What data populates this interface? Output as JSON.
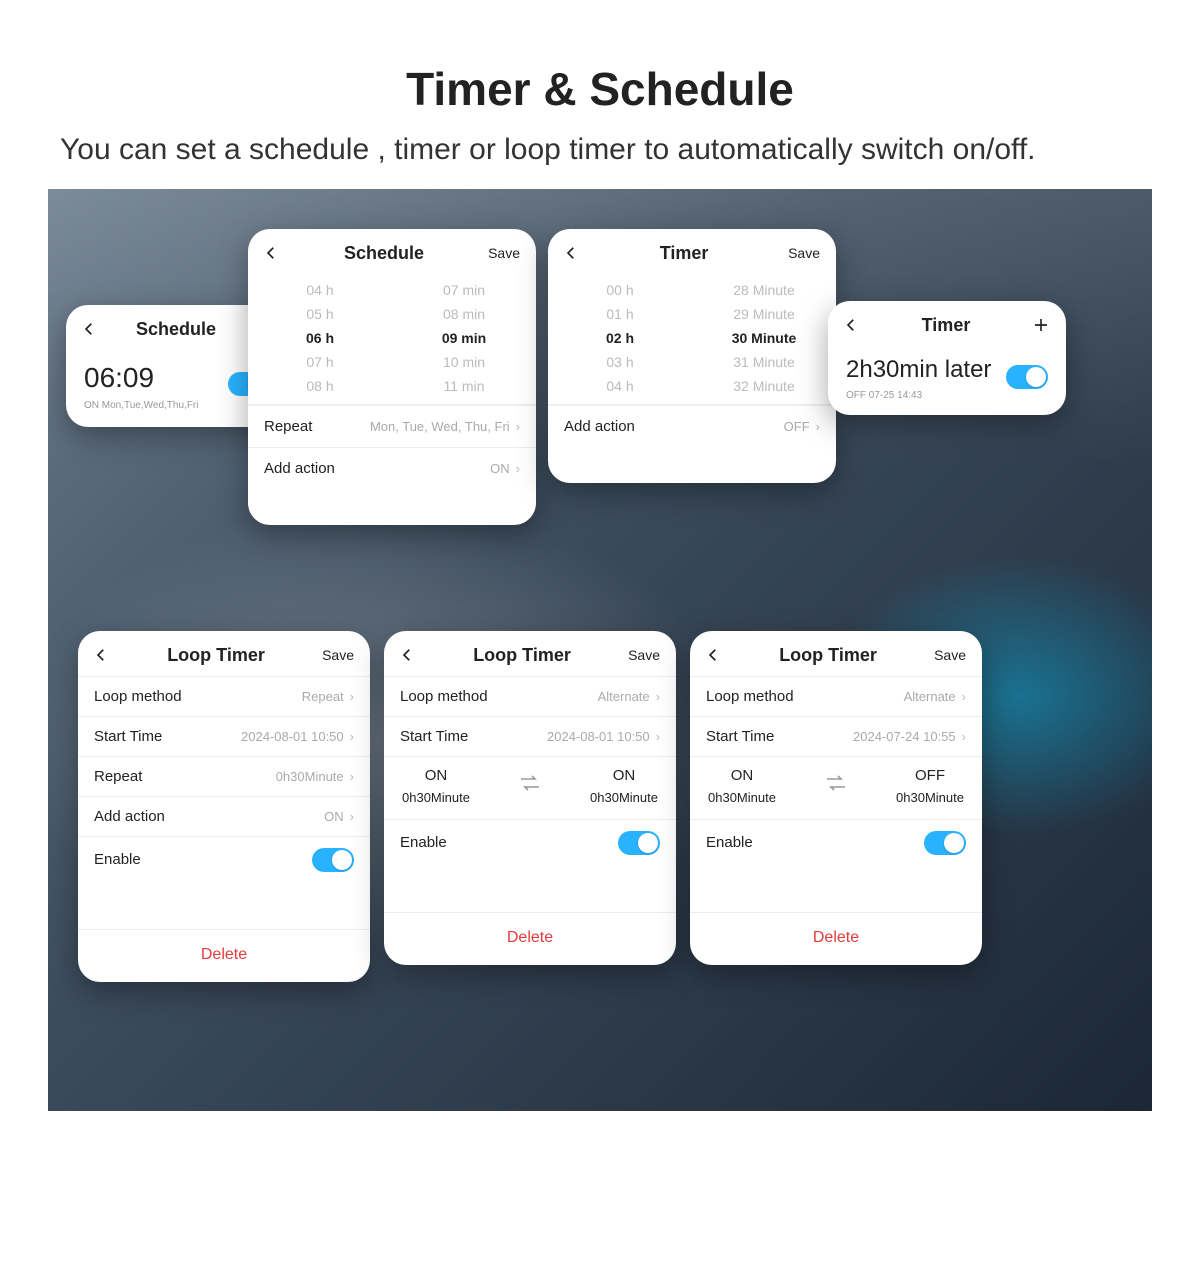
{
  "colors": {
    "accent": "#29b3ff",
    "danger": "#e43b3b"
  },
  "labels": {
    "save": "Save",
    "delete": "Delete",
    "add_action": "Add action",
    "enable": "Enable",
    "repeat": "Repeat",
    "loop_method": "Loop method",
    "start_time": "Start Time"
  },
  "header": {
    "title": "Timer & Schedule",
    "subtitle": "You can set a schedule , timer or loop timer to automatically switch on/off."
  },
  "schedule_small": {
    "title": "Schedule",
    "time": "06:09",
    "status": "ON   Mon,Tue,Wed,Thu,Fri",
    "toggle_on": true
  },
  "schedule_big": {
    "title": "Schedule",
    "hours": [
      "04 h",
      "05 h",
      "06 h",
      "07 h",
      "08 h"
    ],
    "minutes": [
      "07 min",
      "08 min",
      "09 min",
      "10 min",
      "11 min"
    ],
    "selected_hour_index": 2,
    "selected_minute_index": 2,
    "repeat_value": "Mon, Tue, Wed, Thu, Fri",
    "action_value": "ON"
  },
  "timer_big": {
    "title": "Timer",
    "hours": [
      "00 h",
      "01 h",
      "02 h",
      "03 h",
      "04 h"
    ],
    "minutes": [
      "28 Minute",
      "29 Minute",
      "30 Minute",
      "31 Minute",
      "32 Minute"
    ],
    "selected_hour_index": 2,
    "selected_minute_index": 2,
    "action_value": "OFF"
  },
  "timer_small": {
    "title": "Timer",
    "main": "2h30min later",
    "sub": "OFF   07-25 14:43",
    "toggle_on": true
  },
  "loop1": {
    "title": "Loop Timer",
    "method": "Repeat",
    "start": "2024-08-01 10:50",
    "repeat_value": "0h30Minute",
    "action_value": "ON",
    "enable": true
  },
  "loop2": {
    "title": "Loop Timer",
    "method": "Alternate",
    "start": "2024-08-01 10:50",
    "left_state": "ON",
    "left_dur": "0h30Minute",
    "right_state": "ON",
    "right_dur": "0h30Minute",
    "enable": true
  },
  "loop3": {
    "title": "Loop Timer",
    "method": "Alternate",
    "start": "2024-07-24 10:55",
    "left_state": "ON",
    "left_dur": "0h30Minute",
    "right_state": "OFF",
    "right_dur": "0h30Minute",
    "enable": true
  }
}
